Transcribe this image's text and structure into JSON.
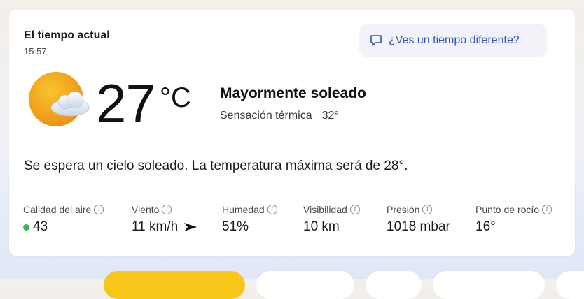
{
  "card": {
    "title": "El tiempo actual",
    "time": "15:57",
    "feedback_button": "¿Ves un tiempo diferente?",
    "weather_icon": "sun-behind-cloud-icon",
    "temperature": "27",
    "unit": "°C",
    "condition": "Mayormente soleado",
    "feels_like_label": "Sensación térmica",
    "feels_like_value": "32°",
    "summary": "Se espera un cielo soleado. La temperatura máxima será de 28°."
  },
  "metrics": [
    {
      "label": "Calidad del aire",
      "value": "43",
      "status_color": "#3fb34f"
    },
    {
      "label": "Viento",
      "value": "11 km/h",
      "icon": "wind-direction-arrow-icon"
    },
    {
      "label": "Humedad",
      "value": "51%"
    },
    {
      "label": "Visibilidad",
      "value": "10 km"
    },
    {
      "label": "Presión",
      "value": "1018 mbar"
    },
    {
      "label": "Punto de rocío",
      "value": "16°"
    }
  ],
  "colors": {
    "accent": "#3a52b4",
    "sun": "#f2a51a",
    "tab_active": "#f6c719"
  }
}
